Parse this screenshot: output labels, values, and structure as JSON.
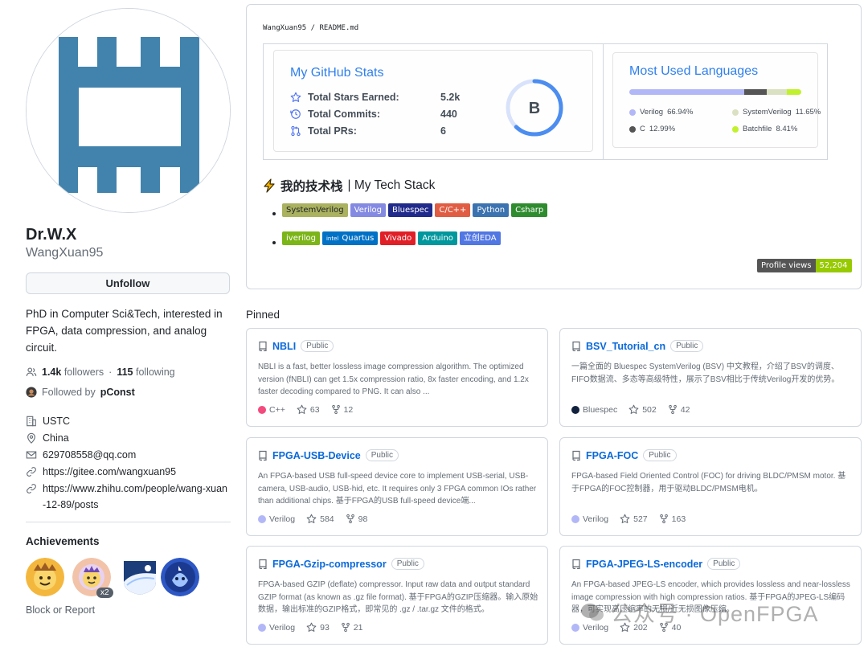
{
  "profile": {
    "name": "Dr.W.X",
    "login": "WangXuan95",
    "follow_button": "Unfollow",
    "bio": "PhD in Computer Sci&Tech, interested in FPGA, data compression, and analog circuit.",
    "followers_count": "1.4k",
    "followers_label": "followers",
    "following_count": "115",
    "following_label": "following",
    "followed_by_prefix": "Followed by",
    "followed_by_user": "pConst",
    "org": "USTC",
    "location": "China",
    "email": "629708558@qq.com",
    "link1": "https://gitee.com/wangxuan95",
    "link2": "https://www.zhihu.com/people/wang-xuan-12-89/posts",
    "achievements_title": "Achievements",
    "achievement_count": "x2",
    "block_report": "Block or Report"
  },
  "readme": {
    "path": "WangXuan95 / README.md",
    "stats": {
      "title": "My GitHub Stats",
      "rows": [
        {
          "label": "Total Stars Earned:",
          "value": "5.2k",
          "icon": "star-icon"
        },
        {
          "label": "Total Commits:",
          "value": "440",
          "icon": "history-icon"
        },
        {
          "label": "Total PRs:",
          "value": "6",
          "icon": "pull-request-icon"
        }
      ],
      "grade": "B",
      "grade_progress": 0.62
    },
    "languages": {
      "title": "Most Used Languages",
      "items": [
        {
          "name": "Verilog",
          "pct": "66.94%",
          "value": 66.94,
          "color": "#b2b7f8"
        },
        {
          "name": "SystemVerilog",
          "pct": "11.65%",
          "value": 11.65,
          "color": "#dae1c2"
        },
        {
          "name": "C",
          "pct": "12.99%",
          "value": 12.99,
          "color": "#555555"
        },
        {
          "name": "Batchfile",
          "pct": "8.41%",
          "value": 8.41,
          "color": "#c1f12e"
        }
      ]
    },
    "tech_stack": {
      "title_zh": "我的技术栈",
      "title_en": "| My Tech Stack",
      "row1": [
        {
          "label": "SystemVerilog",
          "color": "#aab15f",
          "text_color": "#1f2328"
        },
        {
          "label": "Verilog",
          "color": "#848ae2",
          "text_color": "#ffffff"
        },
        {
          "label": "Bluespec",
          "color": "#202a8a",
          "text_color": "#ffffff"
        },
        {
          "label": "C/C++",
          "color": "#e05d44",
          "text_color": "#ffffff"
        },
        {
          "label": "Python",
          "color": "#3b73b0",
          "text_color": "#ffffff"
        },
        {
          "label": "Csharp",
          "color": "#2e8b2e",
          "text_color": "#ffffff"
        }
      ],
      "row2": [
        {
          "label": "iverilog",
          "color": "#7cb518",
          "text_color": "#ffffff"
        },
        {
          "label": "Quartus",
          "color": "#0071c5",
          "text_color": "#ffffff",
          "prefix": "intel"
        },
        {
          "label": "Vivado",
          "color": "#e01f27",
          "text_color": "#ffffff"
        },
        {
          "label": "Arduino",
          "color": "#00979d",
          "text_color": "#ffffff"
        },
        {
          "label": "立创EDA",
          "color": "#5177e3",
          "text_color": "#ffffff"
        }
      ]
    },
    "profile_views_label": "Profile views",
    "profile_views_value": "52,204"
  },
  "pinned": {
    "title": "Pinned",
    "public_label": "Public",
    "repos": [
      {
        "name": "NBLI",
        "desc": "NBLI is a fast, better lossless image compression algorithm. The optimized version (fNBLI) can get 1.5x compression ratio, 8x faster encoding, and 1.2x faster decoding compared to PNG. It can also ...",
        "lang": "C++",
        "lang_color": "#f34b7d",
        "stars": "63",
        "forks": "12"
      },
      {
        "name": "BSV_Tutorial_cn",
        "desc": "一篇全面的 Bluespec SystemVerilog (BSV) 中文教程，介绍了BSV的调度、FIFO数据流、多态等高级特性，展示了BSV相比于传统Verilog开发的优势。",
        "lang": "Bluespec",
        "lang_color": "#12223c",
        "stars": "502",
        "forks": "42"
      },
      {
        "name": "FPGA-USB-Device",
        "desc": "An FPGA-based USB full-speed device core to implement USB-serial, USB-camera, USB-audio, USB-hid, etc. It requires only 3 FPGA common IOs rather than additional chips. 基于FPGA的USB full-speed device端...",
        "lang": "Verilog",
        "lang_color": "#b2b7f8",
        "stars": "584",
        "forks": "98"
      },
      {
        "name": "FPGA-FOC",
        "desc": "FPGA-based Field Oriented Control (FOC) for driving BLDC/PMSM motor. 基于FPGA的FOC控制器，用于驱动BLDC/PMSM电机。",
        "lang": "Verilog",
        "lang_color": "#b2b7f8",
        "stars": "527",
        "forks": "163"
      },
      {
        "name": "FPGA-Gzip-compressor",
        "desc": "FPGA-based GZIP (deflate) compressor. Input raw data and output standard GZIP format (as known as .gz file format). 基于FPGA的GZIP压缩器。输入原始数据，输出标准的GZIP格式，即常见的 .gz / .tar.gz 文件的格式。",
        "lang": "Verilog",
        "lang_color": "#b2b7f8",
        "stars": "93",
        "forks": "21"
      },
      {
        "name": "FPGA-JPEG-LS-encoder",
        "desc": "An FPGA-based JPEG-LS encoder, which provides lossless and near-lossless image compression with high compression ratios. 基于FPGA的JPEG-LS编码器，可实现高压缩率的无损/近无损图像压缩。",
        "lang": "Verilog",
        "lang_color": "#b2b7f8",
        "stars": "202",
        "forks": "40"
      }
    ]
  },
  "watermark": "公众号 · OpenFPGA"
}
